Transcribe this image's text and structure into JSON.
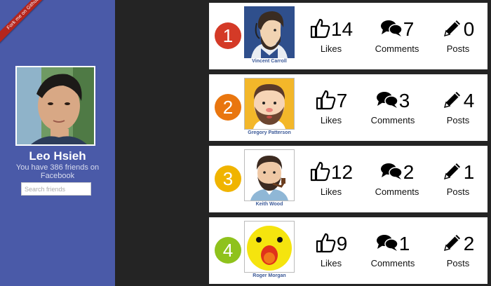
{
  "ribbon": {
    "label": "Fork me on Github"
  },
  "profile": {
    "name": "Leo Hsieh",
    "friend_count_text": "You have 386 friends on Facebook"
  },
  "search": {
    "placeholder": "Search friends"
  },
  "stat_labels": {
    "likes": "Likes",
    "comments": "Comments",
    "posts": "Posts"
  },
  "friends": [
    {
      "rank": "1",
      "name": "Vincent Carroll",
      "likes": "14",
      "comments": "7",
      "posts": "0",
      "rank_color": "#d43a27"
    },
    {
      "rank": "2",
      "name": "Gregory Patterson",
      "likes": "7",
      "comments": "3",
      "posts": "4",
      "rank_color": "#e9760f"
    },
    {
      "rank": "3",
      "name": "Keith Wood",
      "likes": "12",
      "comments": "2",
      "posts": "1",
      "rank_color": "#f0b400"
    },
    {
      "rank": "4",
      "name": "Roger Morgan",
      "likes": "9",
      "comments": "1",
      "posts": "2",
      "rank_color": "#8fc21c"
    }
  ]
}
